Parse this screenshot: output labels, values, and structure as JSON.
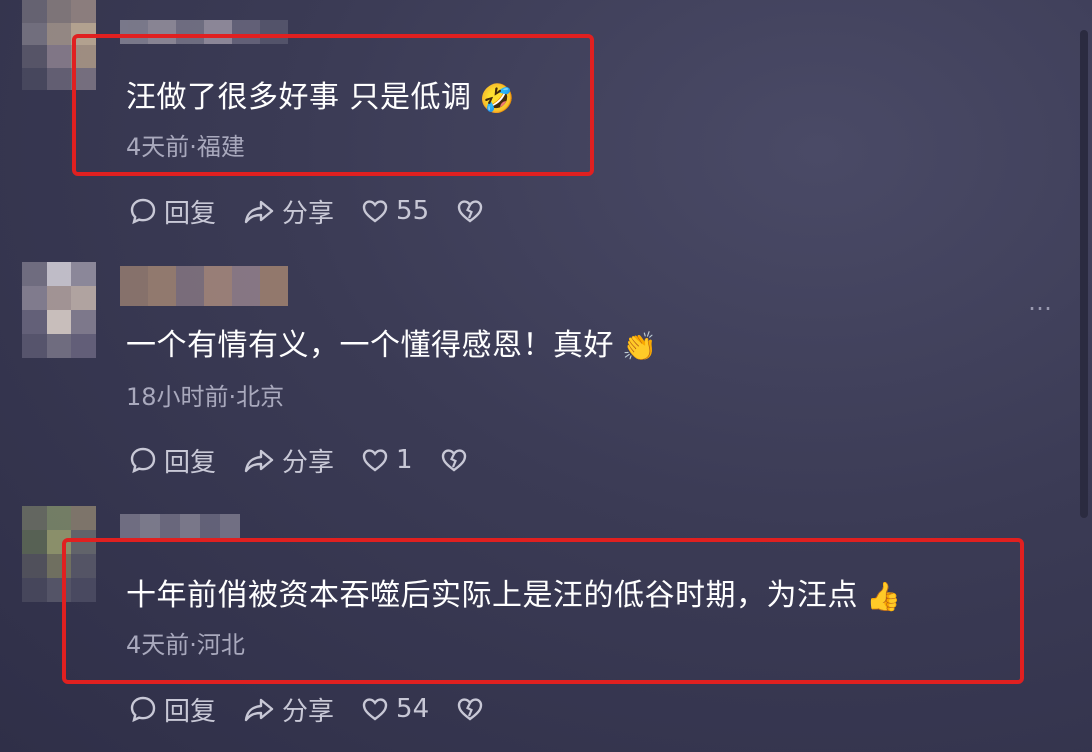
{
  "comments": [
    {
      "text": "汪做了很多好事 只是低调",
      "emoji": "🤣",
      "meta": "4天前·福建",
      "reply_label": "回复",
      "share_label": "分享",
      "likes": "55"
    },
    {
      "text": "一个有情有义，一个懂得感恩！真好",
      "emoji": "👏",
      "meta": "18小时前·北京",
      "reply_label": "回复",
      "share_label": "分享",
      "likes": "1"
    },
    {
      "text": "十年前俏被资本吞噬后实际上是汪的低谷时期，为汪点",
      "emoji": "👍",
      "meta": "4天前·河北",
      "reply_label": "回复",
      "share_label": "分享",
      "likes": "54"
    }
  ],
  "more_icon": "…",
  "colors": {
    "highlight": "#e02020",
    "meta_text": "#a9a9bd",
    "action_text": "#c8c8d6"
  }
}
